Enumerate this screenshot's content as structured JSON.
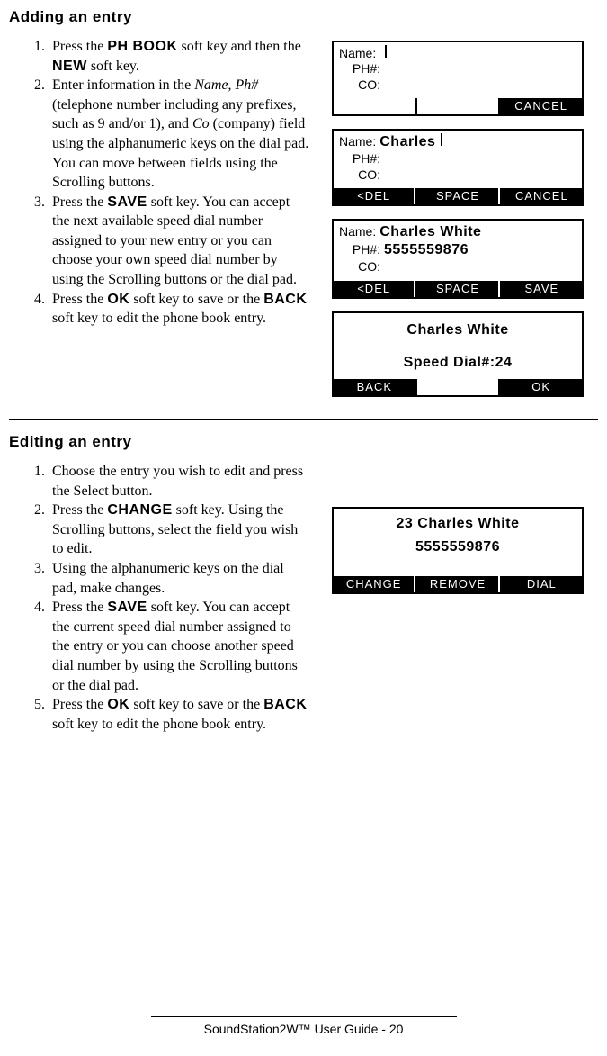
{
  "section1": {
    "title": "Adding an entry",
    "steps": {
      "s1a": "Press the ",
      "s1b": "PH BOOK",
      "s1c": " soft key and then the ",
      "s1d": "NEW",
      "s1e": " soft key.",
      "s2a": "Enter information in the ",
      "s2b": "Name",
      "s2c": ", ",
      "s2d": "Ph#",
      "s2e": " (telephone number includ­ing any prefixes, such as 9 and/or 1), and ",
      "s2f": "Co",
      "s2g": " (company) field using the alphanumeric keys on the dial pad.  You can move between fields using the Scrolling buttons.",
      "s3a": "Press the ",
      "s3b": "SAVE",
      "s3c": " soft key.  You can accept the next available speed dial number assigned to your new entry or you can choose your own speed dial number by using the Scrolling buttons or the dial pad.",
      "s4a": "Press the ",
      "s4b": "OK",
      "s4c": " soft key to save or the ",
      "s4d": "BACK",
      "s4e": " soft key to edit the phone book entry."
    }
  },
  "section2": {
    "title": "Editing an entry",
    "steps": {
      "s1": "Choose the entry you wish to edit and press the Select button.",
      "s2a": "Press the ",
      "s2b": "CHANGE",
      "s2c": " soft key.  Using the Scrolling buttons, select the field you wish to edit.",
      "s3": "Using the alphanumeric keys on the dial pad, make changes.",
      "s4a": "Press the ",
      "s4b": "SAVE",
      "s4c": " soft key.  You can accept the current speed dial number assigned to the entry or you can choose another speed dial number by using the Scrolling buttons or the dial pad.",
      "s5a": "Press the ",
      "s5b": "OK",
      "s5c": " soft key to save or the ",
      "s5d": "BACK",
      "s5e": " soft key to edit the phone book entry."
    }
  },
  "lcd_labels": {
    "name": "Name:",
    "ph": "PH#:",
    "co": "CO:"
  },
  "screens": {
    "a": {
      "name_val": "",
      "ph_val": "",
      "co_val": "",
      "sk": [
        "",
        "",
        "CANCEL"
      ]
    },
    "b": {
      "name_val": "Charles",
      "ph_val": "",
      "co_val": "",
      "sk": [
        "<DEL",
        "SPACE",
        "CANCEL"
      ]
    },
    "c": {
      "name_val": "Charles White",
      "ph_val": "5555559876",
      "co_val": "",
      "sk": [
        "<DEL",
        "SPACE",
        "SAVE"
      ]
    },
    "d": {
      "line1": "Charles White",
      "line2": "Speed Dial#:24",
      "sk": [
        "BACK",
        "",
        "OK"
      ]
    },
    "e": {
      "line1": "23 Charles White",
      "line2": "5555559876",
      "sk": [
        "CHANGE",
        "REMOVE",
        "DIAL"
      ]
    }
  },
  "footer": "SoundStation2W™ User Guide - 20"
}
